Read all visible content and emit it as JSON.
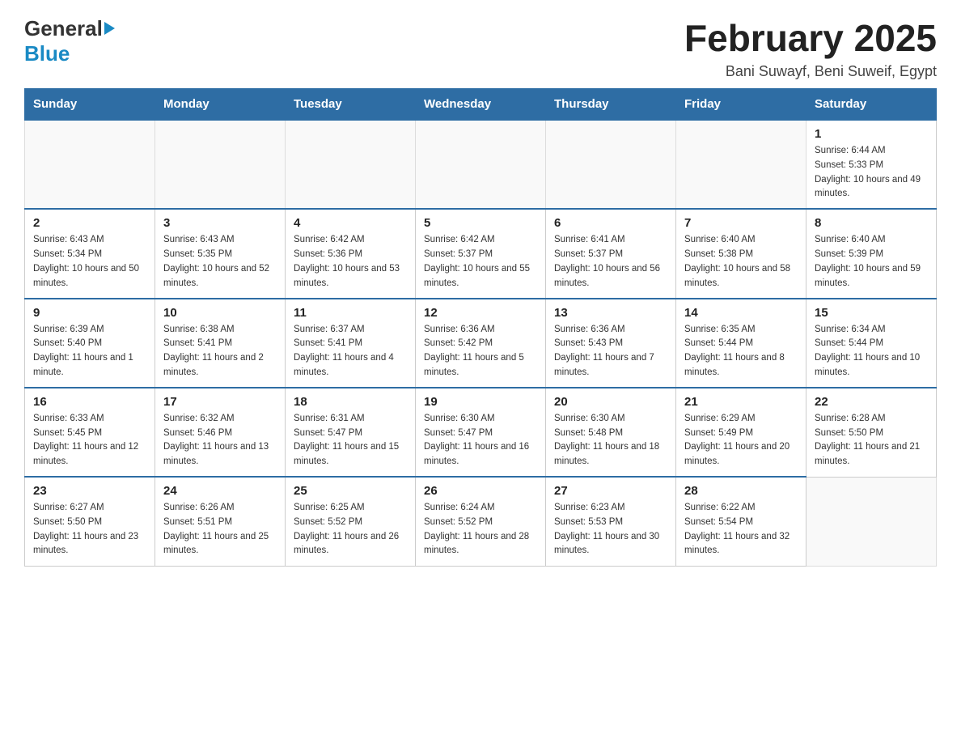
{
  "header": {
    "logo_general": "General",
    "logo_blue": "Blue",
    "title": "February 2025",
    "subtitle": "Bani Suwayf, Beni Suweif, Egypt"
  },
  "days_of_week": [
    "Sunday",
    "Monday",
    "Tuesday",
    "Wednesday",
    "Thursday",
    "Friday",
    "Saturday"
  ],
  "weeks": [
    [
      {
        "day": "",
        "info": ""
      },
      {
        "day": "",
        "info": ""
      },
      {
        "day": "",
        "info": ""
      },
      {
        "day": "",
        "info": ""
      },
      {
        "day": "",
        "info": ""
      },
      {
        "day": "",
        "info": ""
      },
      {
        "day": "1",
        "info": "Sunrise: 6:44 AM\nSunset: 5:33 PM\nDaylight: 10 hours and 49 minutes."
      }
    ],
    [
      {
        "day": "2",
        "info": "Sunrise: 6:43 AM\nSunset: 5:34 PM\nDaylight: 10 hours and 50 minutes."
      },
      {
        "day": "3",
        "info": "Sunrise: 6:43 AM\nSunset: 5:35 PM\nDaylight: 10 hours and 52 minutes."
      },
      {
        "day": "4",
        "info": "Sunrise: 6:42 AM\nSunset: 5:36 PM\nDaylight: 10 hours and 53 minutes."
      },
      {
        "day": "5",
        "info": "Sunrise: 6:42 AM\nSunset: 5:37 PM\nDaylight: 10 hours and 55 minutes."
      },
      {
        "day": "6",
        "info": "Sunrise: 6:41 AM\nSunset: 5:37 PM\nDaylight: 10 hours and 56 minutes."
      },
      {
        "day": "7",
        "info": "Sunrise: 6:40 AM\nSunset: 5:38 PM\nDaylight: 10 hours and 58 minutes."
      },
      {
        "day": "8",
        "info": "Sunrise: 6:40 AM\nSunset: 5:39 PM\nDaylight: 10 hours and 59 minutes."
      }
    ],
    [
      {
        "day": "9",
        "info": "Sunrise: 6:39 AM\nSunset: 5:40 PM\nDaylight: 11 hours and 1 minute."
      },
      {
        "day": "10",
        "info": "Sunrise: 6:38 AM\nSunset: 5:41 PM\nDaylight: 11 hours and 2 minutes."
      },
      {
        "day": "11",
        "info": "Sunrise: 6:37 AM\nSunset: 5:41 PM\nDaylight: 11 hours and 4 minutes."
      },
      {
        "day": "12",
        "info": "Sunrise: 6:36 AM\nSunset: 5:42 PM\nDaylight: 11 hours and 5 minutes."
      },
      {
        "day": "13",
        "info": "Sunrise: 6:36 AM\nSunset: 5:43 PM\nDaylight: 11 hours and 7 minutes."
      },
      {
        "day": "14",
        "info": "Sunrise: 6:35 AM\nSunset: 5:44 PM\nDaylight: 11 hours and 8 minutes."
      },
      {
        "day": "15",
        "info": "Sunrise: 6:34 AM\nSunset: 5:44 PM\nDaylight: 11 hours and 10 minutes."
      }
    ],
    [
      {
        "day": "16",
        "info": "Sunrise: 6:33 AM\nSunset: 5:45 PM\nDaylight: 11 hours and 12 minutes."
      },
      {
        "day": "17",
        "info": "Sunrise: 6:32 AM\nSunset: 5:46 PM\nDaylight: 11 hours and 13 minutes."
      },
      {
        "day": "18",
        "info": "Sunrise: 6:31 AM\nSunset: 5:47 PM\nDaylight: 11 hours and 15 minutes."
      },
      {
        "day": "19",
        "info": "Sunrise: 6:30 AM\nSunset: 5:47 PM\nDaylight: 11 hours and 16 minutes."
      },
      {
        "day": "20",
        "info": "Sunrise: 6:30 AM\nSunset: 5:48 PM\nDaylight: 11 hours and 18 minutes."
      },
      {
        "day": "21",
        "info": "Sunrise: 6:29 AM\nSunset: 5:49 PM\nDaylight: 11 hours and 20 minutes."
      },
      {
        "day": "22",
        "info": "Sunrise: 6:28 AM\nSunset: 5:50 PM\nDaylight: 11 hours and 21 minutes."
      }
    ],
    [
      {
        "day": "23",
        "info": "Sunrise: 6:27 AM\nSunset: 5:50 PM\nDaylight: 11 hours and 23 minutes."
      },
      {
        "day": "24",
        "info": "Sunrise: 6:26 AM\nSunset: 5:51 PM\nDaylight: 11 hours and 25 minutes."
      },
      {
        "day": "25",
        "info": "Sunrise: 6:25 AM\nSunset: 5:52 PM\nDaylight: 11 hours and 26 minutes."
      },
      {
        "day": "26",
        "info": "Sunrise: 6:24 AM\nSunset: 5:52 PM\nDaylight: 11 hours and 28 minutes."
      },
      {
        "day": "27",
        "info": "Sunrise: 6:23 AM\nSunset: 5:53 PM\nDaylight: 11 hours and 30 minutes."
      },
      {
        "day": "28",
        "info": "Sunrise: 6:22 AM\nSunset: 5:54 PM\nDaylight: 11 hours and 32 minutes."
      },
      {
        "day": "",
        "info": ""
      }
    ]
  ]
}
